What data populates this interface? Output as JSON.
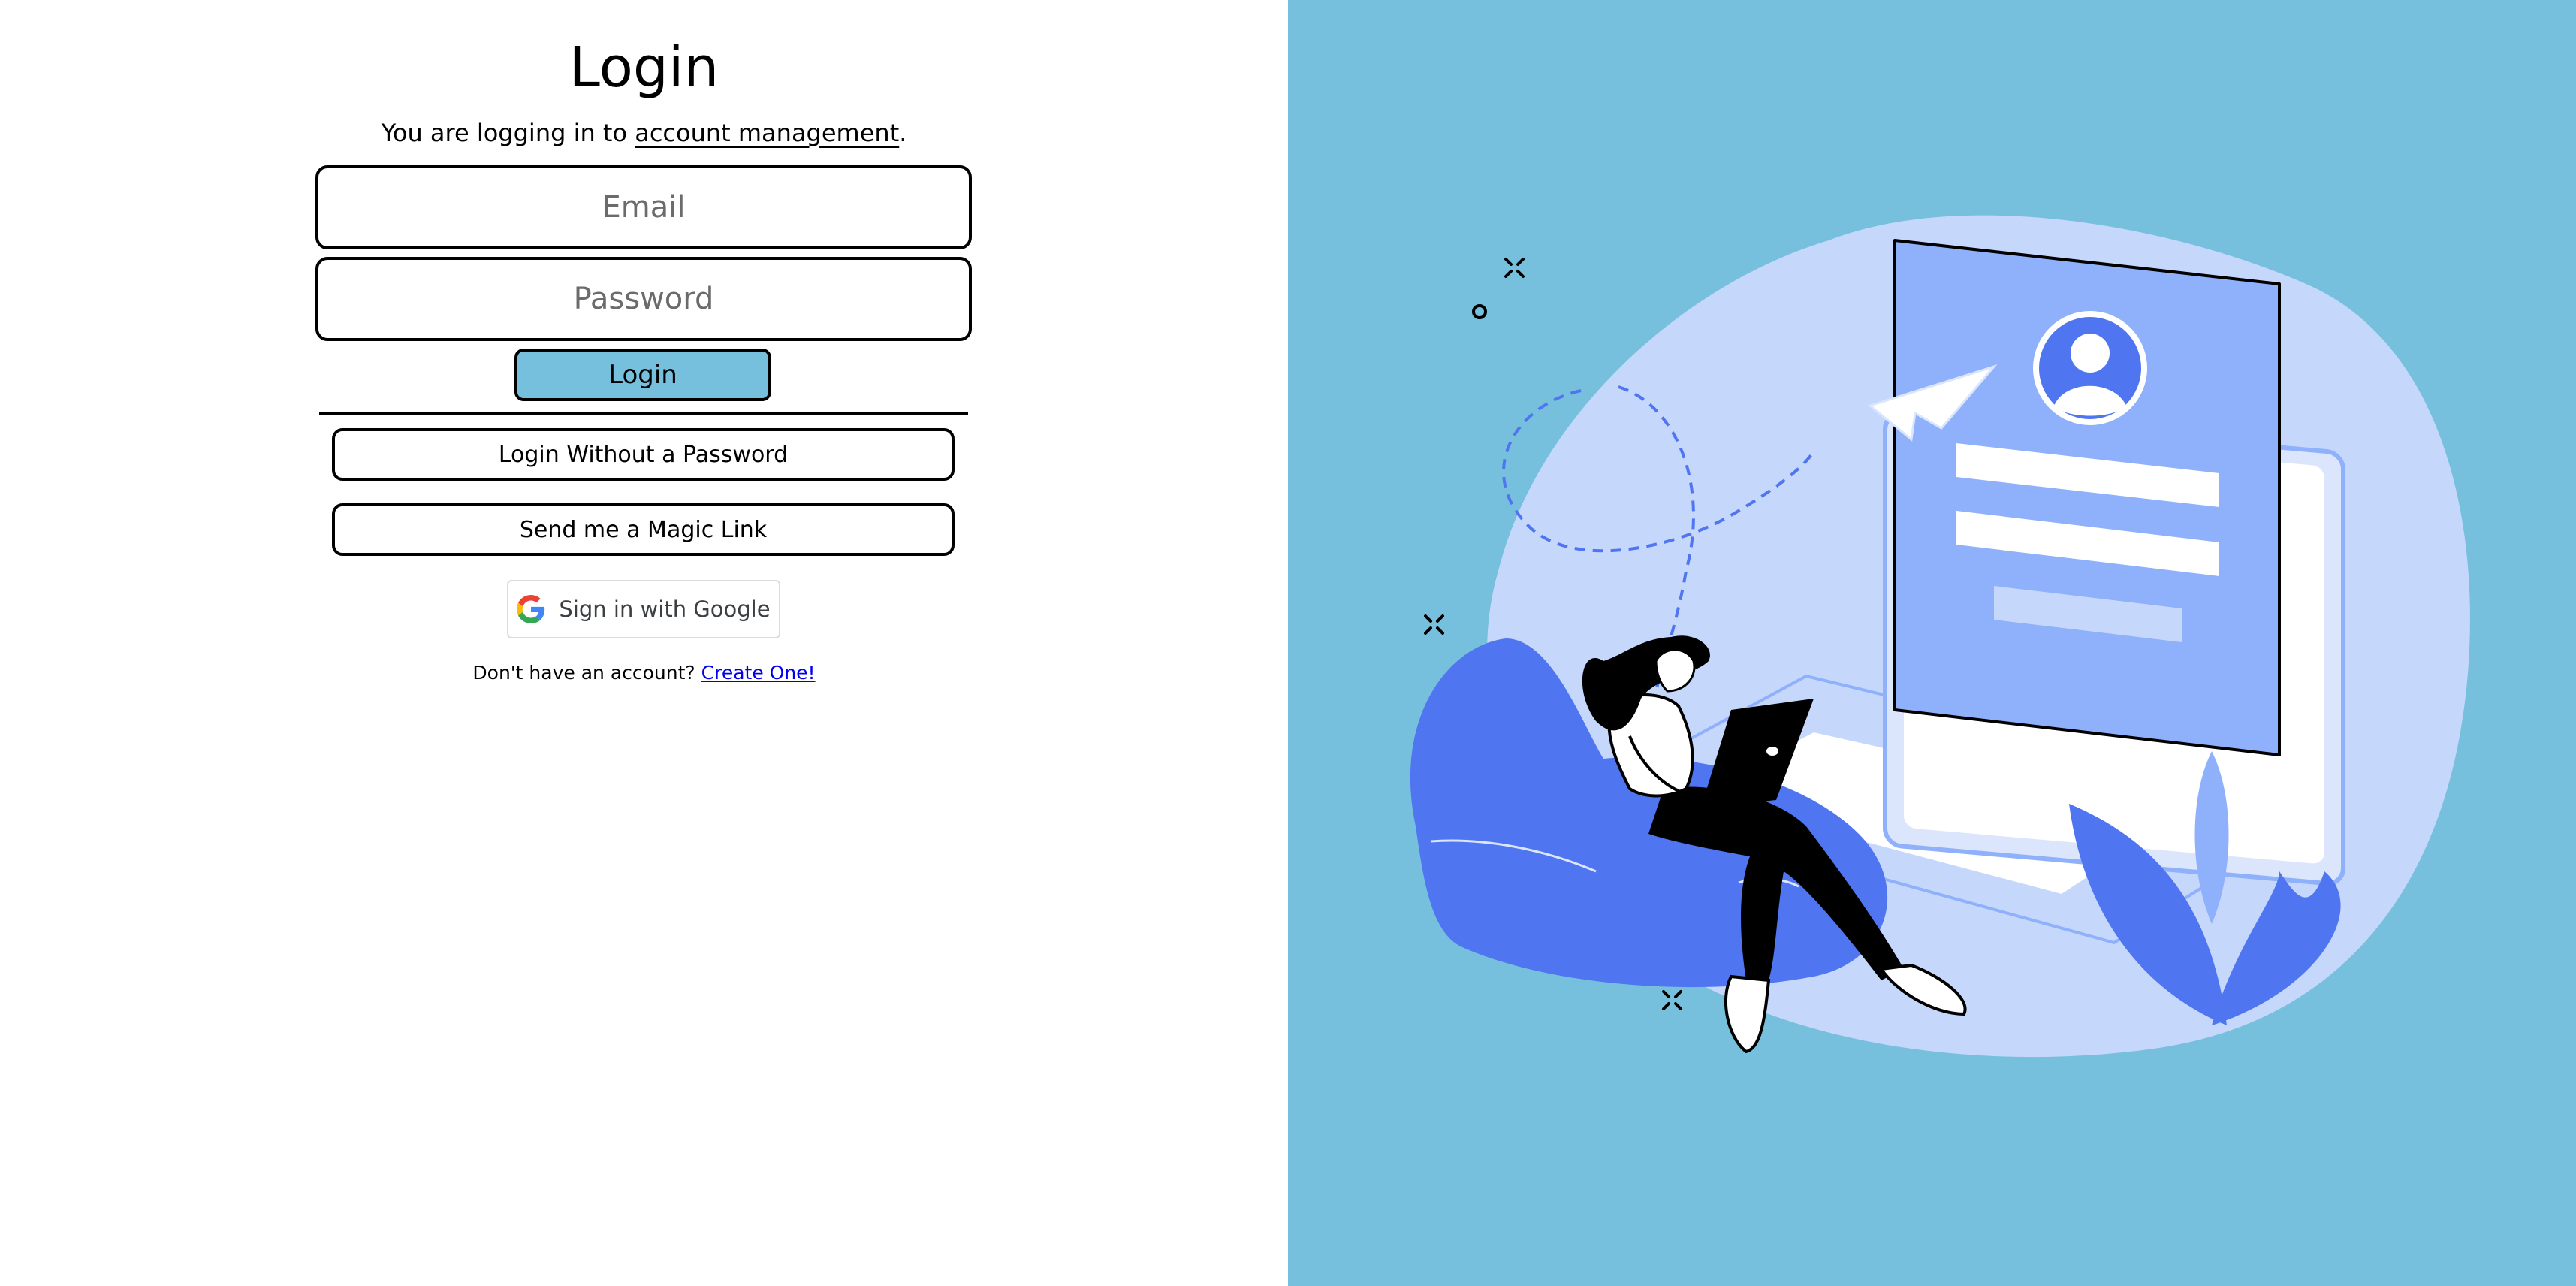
{
  "login": {
    "title": "Login",
    "subtitle_prefix": "You are logging in to ",
    "subtitle_link": "account management",
    "subtitle_suffix": ".",
    "email_placeholder": "Email",
    "password_placeholder": "Password",
    "login_button": "Login",
    "passwordless_button": "Login Without a Password",
    "magic_link_button": "Send me a Magic Link",
    "google_button": "Sign in with Google",
    "signup_prompt": "Don't have an account? ",
    "signup_link": "Create One!"
  },
  "icons": {
    "google": "google-g-icon"
  },
  "colors": {
    "accent": "#76c0dd",
    "panel": "#77c0dd",
    "illustration_blue": "#5075f0",
    "illustration_light": "#c6d7fc",
    "illustration_mid": "#8fb0fa",
    "link": "#0000ee"
  }
}
